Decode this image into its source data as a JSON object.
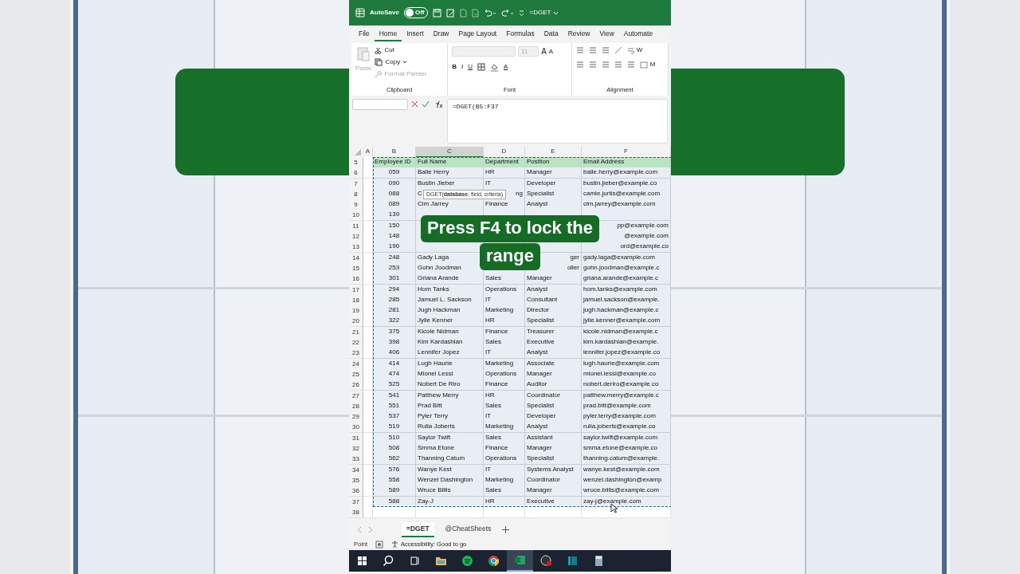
{
  "title_bar": {
    "autosave_label": "AutoSave",
    "autosave": {
      "label": "Off",
      "on": false
    },
    "file_name": "=DGET"
  },
  "menu_tabs": [
    {
      "label": "File",
      "selected": false
    },
    {
      "label": "Home",
      "selected": true
    },
    {
      "label": "Insert",
      "selected": false
    },
    {
      "label": "Draw",
      "selected": false
    },
    {
      "label": "Page Layout",
      "selected": false
    },
    {
      "label": "Formulas",
      "selected": false
    },
    {
      "label": "Data",
      "selected": false
    },
    {
      "label": "Review",
      "selected": false
    },
    {
      "label": "View",
      "selected": false
    },
    {
      "label": "Automate",
      "selected": false
    }
  ],
  "ribbon": {
    "clipboard": {
      "paste": {
        "label": "Paste",
        "disabled": true
      },
      "cut": "Cut",
      "copy": "Copy",
      "format_painter": {
        "label": "Format Painter",
        "disabled": true
      },
      "group_label": "Clipboard"
    },
    "font": {
      "size": "11",
      "grow": "A",
      "shrink": "A",
      "bold": "B",
      "italic": "I",
      "underline": "U",
      "font_color": "A",
      "group_label": "Font"
    },
    "alignment": {
      "wrap_label": "W",
      "merge_label": "M",
      "group_label": "Alignment"
    }
  },
  "formula_bar": {
    "formula": "=DGET(B5:F37"
  },
  "columns": [
    {
      "label": "A",
      "selected": false
    },
    {
      "label": "B",
      "selected": false
    },
    {
      "label": "C",
      "selected": true
    },
    {
      "label": "D",
      "selected": false
    },
    {
      "label": "E",
      "selected": false
    },
    {
      "label": "F",
      "selected": false
    }
  ],
  "rows": [
    {
      "number": "5",
      "kind": "header",
      "cells": [
        "Employee ID",
        "Full Name",
        "Department",
        "Position",
        "Email Address"
      ]
    },
    {
      "number": "6",
      "kind": "data",
      "cells": [
        "059",
        "Balle Herry",
        "HR",
        "Manager",
        "balle.herry@example.com"
      ]
    },
    {
      "number": "7",
      "kind": "data",
      "cells": [
        "090",
        "Bustin Jieber",
        "IT",
        "Developer",
        "bustin.jieber@example.co"
      ]
    },
    {
      "number": "8",
      "kind": "data",
      "cells": [
        "088",
        "C",
        {
          "text": "ng",
          "cut_start": true
        },
        "Specialist",
        "camie.jurtis@example.com"
      ]
    },
    {
      "number": "9",
      "kind": "data",
      "cells": [
        "089",
        "Cim Jarrey",
        "Finance",
        "Analyst",
        "cim.jarrey@example.com"
      ]
    },
    {
      "number": "10",
      "kind": "data",
      "cells": [
        "139",
        null,
        null,
        null,
        null
      ]
    },
    {
      "number": "11",
      "kind": "data",
      "cells": [
        "150",
        null,
        null,
        null,
        {
          "text": "pp@example.com",
          "cut_start": true
        }
      ]
    },
    {
      "number": "12",
      "kind": "data",
      "cells": [
        "148",
        null,
        null,
        null,
        {
          "text": "@example.com",
          "cut_start": true
        }
      ]
    },
    {
      "number": "13",
      "kind": "data",
      "cells": [
        "190",
        null,
        null,
        null,
        {
          "text": "ord@example.co",
          "cut_start": true
        }
      ]
    },
    {
      "number": "14",
      "kind": "data",
      "cells": [
        "248",
        "Gady Laga",
        null,
        {
          "text": "ger",
          "cut_start": true
        },
        "gady.laga@example.com"
      ]
    },
    {
      "number": "15",
      "kind": "data",
      "cells": [
        "253",
        "Gohn Joodman",
        null,
        {
          "text": "oller",
          "cut_start": true
        },
        "gohn.joodman@example.c"
      ]
    },
    {
      "number": "16",
      "kind": "data",
      "cells": [
        "301",
        "Griana Arande",
        "Sales",
        "Manager",
        "griana.arande@example.c"
      ]
    },
    {
      "number": "17",
      "kind": "data",
      "cells": [
        "294",
        "Hom Tanks",
        "Operations",
        "Analyst",
        "hom.tanks@example.com"
      ]
    },
    {
      "number": "18",
      "kind": "data",
      "cells": [
        "285",
        "Jamuel L. Sackson",
        "IT",
        "Consultant",
        "jamuel.sackson@example."
      ]
    },
    {
      "number": "19",
      "kind": "data",
      "cells": [
        "281",
        "Jugh Hackman",
        "Marketing",
        "Director",
        "jugh.hackman@example.c"
      ]
    },
    {
      "number": "20",
      "kind": "data",
      "cells": [
        "322",
        "Jylie Kenner",
        "HR",
        "Specialist",
        "jylie.kenner@example.com"
      ]
    },
    {
      "number": "21",
      "kind": "data",
      "cells": [
        "375",
        "Kicole Nidman",
        "Finance",
        "Treasurer",
        "kicole.nidman@example.c"
      ]
    },
    {
      "number": "22",
      "kind": "data",
      "cells": [
        "398",
        "Kim Kardashian",
        "Sales",
        "Executive",
        "kim.kardashian@example."
      ]
    },
    {
      "number": "23",
      "kind": "data",
      "cells": [
        "406",
        "Lennifer Jopez",
        "IT",
        "Analyst",
        "lennifer.jopez@example.co"
      ]
    },
    {
      "number": "24",
      "kind": "data",
      "cells": [
        "414",
        "Lugh Haurie",
        "Marketing",
        "Associate",
        "lugh.haurie@example.com"
      ]
    },
    {
      "number": "25",
      "kind": "data",
      "cells": [
        "474",
        "Mionel Lessi",
        "Operations",
        "Manager",
        "mionel.lessi@example.co"
      ]
    },
    {
      "number": "26",
      "kind": "data",
      "cells": [
        "525",
        "Nobert De Riro",
        "Finance",
        "Auditor",
        "nobert.deriro@example.co"
      ]
    },
    {
      "number": "27",
      "kind": "data",
      "cells": [
        "541",
        "Patthew Merry",
        "HR",
        "Coordinator",
        "patthew.merry@example.c"
      ]
    },
    {
      "number": "28",
      "kind": "data",
      "cells": [
        "551",
        "Prad Bitt",
        "Sales",
        "Specialist",
        "prad.bitt@example.com"
      ]
    },
    {
      "number": "29",
      "kind": "data",
      "cells": [
        "537",
        "Pyler Terry",
        "IT",
        "Developer",
        "pyler.terry@example.com"
      ]
    },
    {
      "number": "30",
      "kind": "data",
      "cells": [
        "519",
        "Rulia Joberts",
        "Marketing",
        "Analyst",
        "rulia.joberts@example.co"
      ]
    },
    {
      "number": "31",
      "kind": "data",
      "cells": [
        "510",
        "Saylor Twift",
        "Sales",
        "Assistant",
        "saylor.twift@example.com"
      ]
    },
    {
      "number": "32",
      "kind": "data",
      "cells": [
        "508",
        "Smma Etone",
        "Finance",
        "Manager",
        "smma.etone@example.co"
      ]
    },
    {
      "number": "33",
      "kind": "data",
      "cells": [
        "562",
        "Thanning Catum",
        "Operations",
        "Specialist",
        "thanning.catum@example."
      ]
    },
    {
      "number": "34",
      "kind": "data",
      "cells": [
        "576",
        "Wanye Kest",
        "IT",
        "Systems Analyst",
        "wanye.kest@example.com"
      ]
    },
    {
      "number": "35",
      "kind": "data",
      "cells": [
        "558",
        "Wenzel Dashington",
        "Marketing",
        "Coordinator",
        "wenzel.dashington@examp"
      ]
    },
    {
      "number": "36",
      "kind": "data",
      "cells": [
        "589",
        "Wruce Billis",
        "Sales",
        "Manager",
        "wruce.billis@example.com"
      ]
    },
    {
      "number": "37",
      "kind": "data",
      "cells": [
        "588",
        "Zay-J",
        "HR",
        "Executive",
        "zay-j@example.com"
      ]
    },
    {
      "number": "38",
      "kind": "empty"
    }
  ],
  "tooltip": "DGET(**database**, field, criteria)",
  "caption_lines": [
    "Press F4 to lock the",
    "range"
  ],
  "sheet_tabs": [
    {
      "label": "=DGET",
      "selected": true
    },
    {
      "label": "@CheatSheets",
      "selected": false
    }
  ],
  "status_bar": {
    "mode": "Point",
    "accessibility": "Accessibility: Good to go"
  },
  "taskbar": [
    {
      "kind": "start",
      "active": false
    },
    {
      "kind": "search",
      "active": false
    },
    {
      "kind": "taskview",
      "active": false
    },
    {
      "kind": "folder",
      "active": false
    },
    {
      "kind": "music",
      "active": false
    },
    {
      "kind": "browser",
      "active": false
    },
    {
      "kind": "sheet",
      "active": true
    },
    {
      "kind": "recorder",
      "active": false
    },
    {
      "kind": "panel",
      "active": false
    },
    {
      "kind": "calculator",
      "active": false
    }
  ]
}
